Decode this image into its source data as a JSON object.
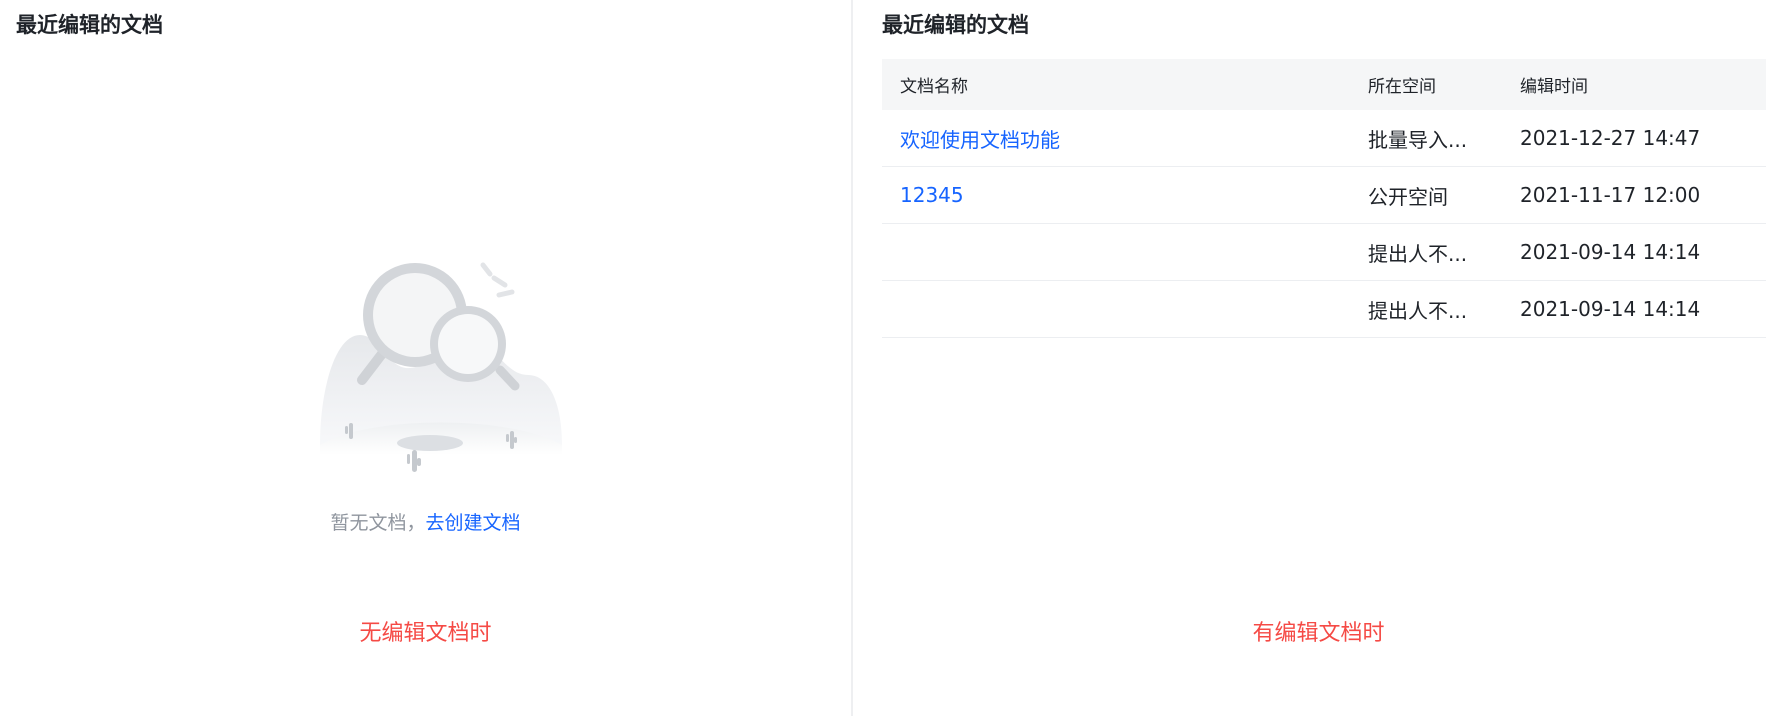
{
  "left_panel": {
    "title": "最近编辑的文档",
    "empty_text": "暂无文档，",
    "create_link": "去创建文档",
    "caption": "无编辑文档时"
  },
  "right_panel": {
    "title": "最近编辑的文档",
    "columns": [
      "文档名称",
      "所在空间",
      "编辑时间"
    ],
    "rows": [
      {
        "name": "欢迎使用文档功能",
        "space": "批量导入...",
        "time": "2021-12-27 14:47"
      },
      {
        "name": "12345",
        "space": "公开空间",
        "time": "2021-11-17 12:00"
      },
      {
        "name": "",
        "space": "提出人不...",
        "time": "2021-09-14 14:14"
      },
      {
        "name": "",
        "space": "提出人不...",
        "time": "2021-09-14 14:14"
      }
    ],
    "caption": "有编辑文档时"
  },
  "colors": {
    "link": "#1664ff",
    "caption": "#f54a45",
    "header_bg": "#f5f6f7",
    "muted": "#8f959e"
  },
  "icons": {
    "empty_state": "magnifier-desert-illustration"
  }
}
